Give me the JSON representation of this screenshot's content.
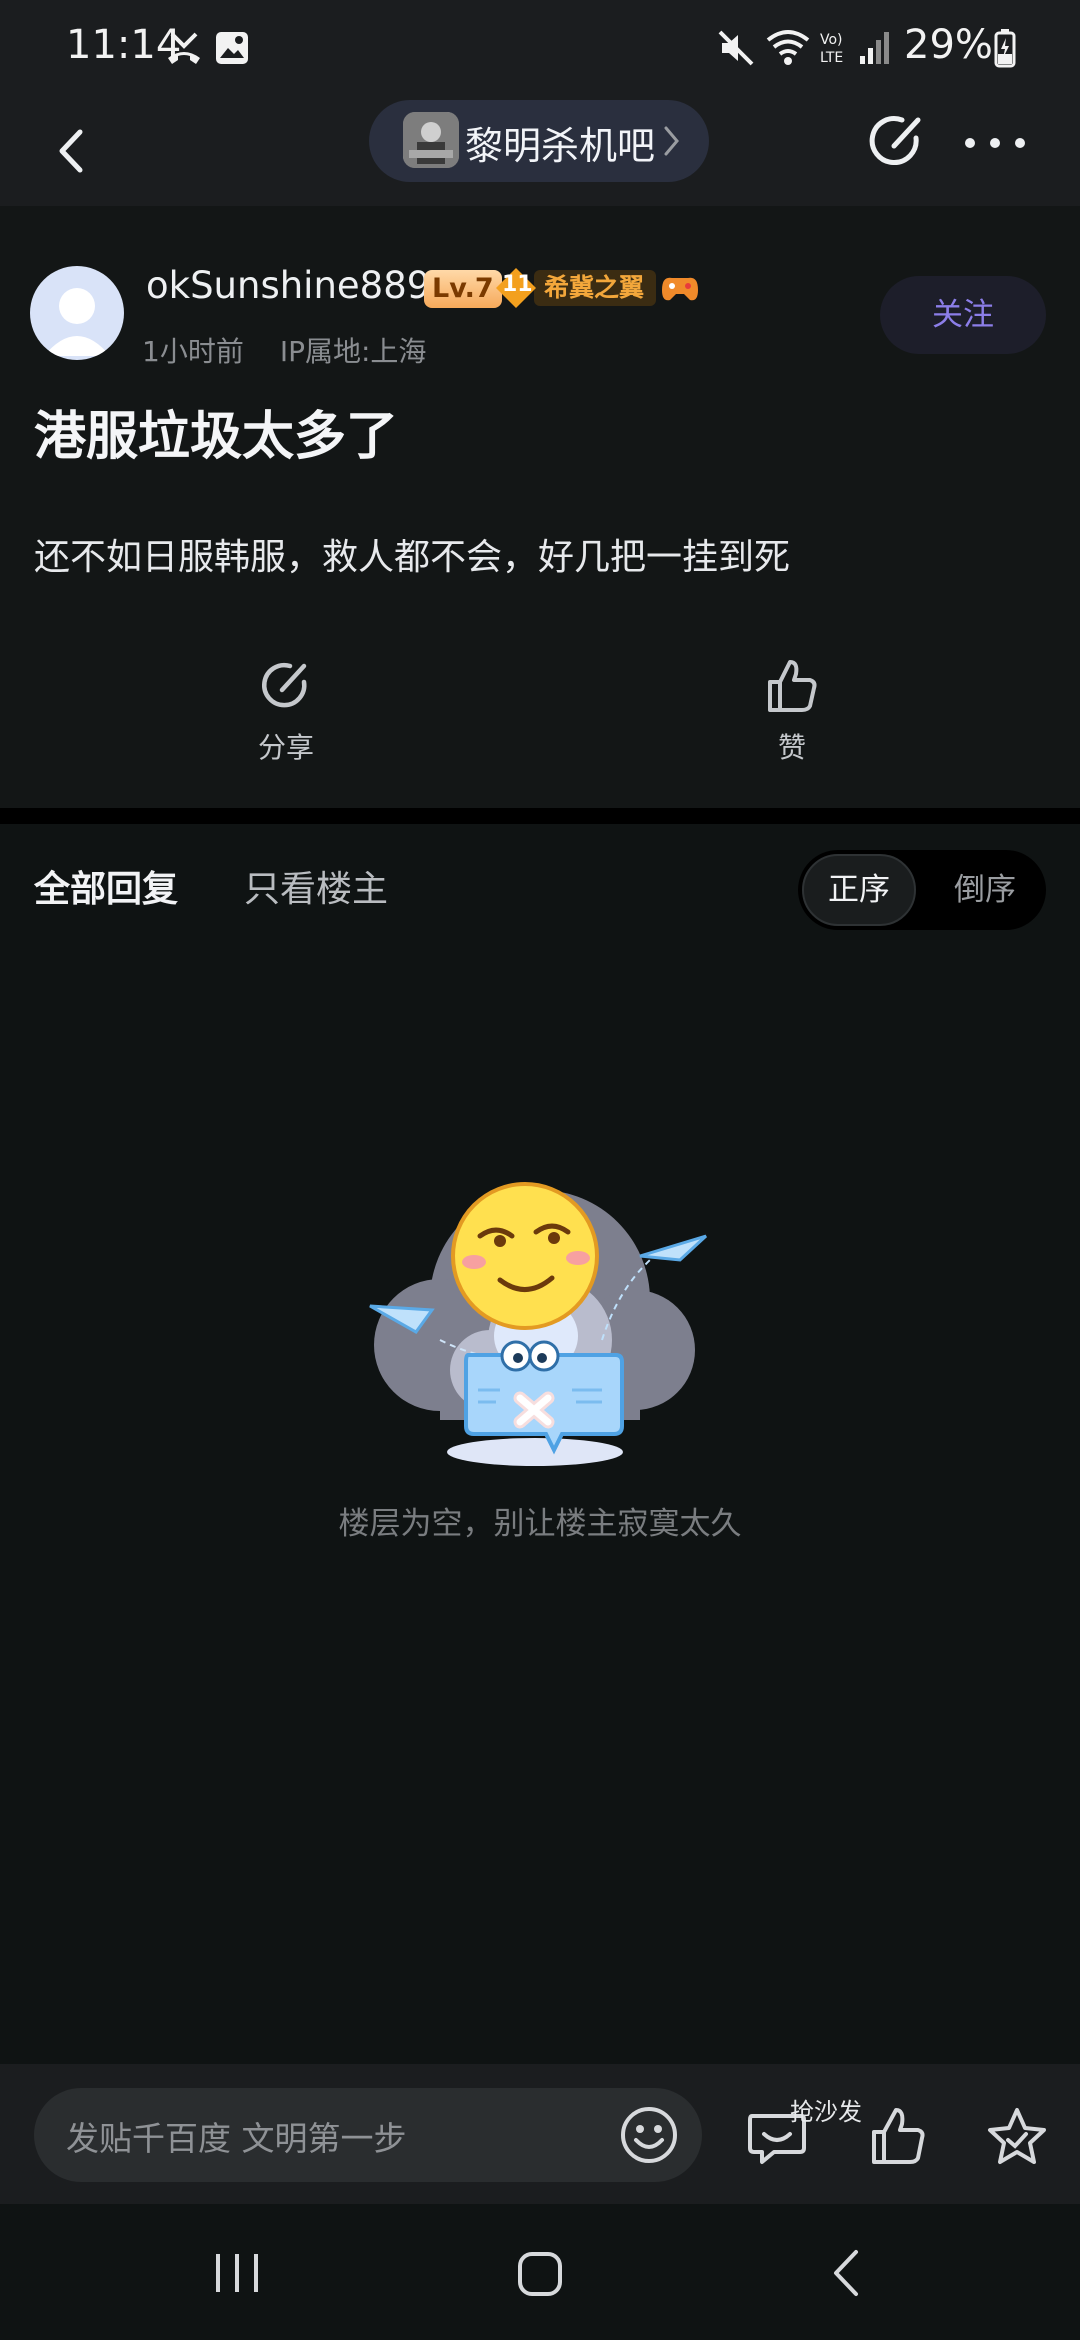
{
  "status_bar": {
    "time": "11:14",
    "battery_percent": "29%",
    "icons": [
      "missed-call-icon",
      "gallery-icon",
      "mute-icon",
      "wifi-icon",
      "volte-icon",
      "signal-icon",
      "battery-charging-icon"
    ]
  },
  "top_nav": {
    "forum_name": "黎明杀机吧",
    "icons": [
      "back-icon",
      "forum-avatar",
      "chevron-right-icon",
      "share-icon",
      "more-icon"
    ]
  },
  "post": {
    "username": "okSunshine889",
    "level_badge": "Lv.7",
    "wing_badge_level": "11",
    "wing_badge_name": "希冀之翼",
    "time_ago": "1小时前",
    "ip_location": "IP属地:上海",
    "follow_label": "关注",
    "title": "港服垃圾太多了",
    "body": "还不如日服韩服，救人都不会，好几把一挂到死",
    "share_label": "分享",
    "like_label": "赞"
  },
  "replies": {
    "tab_all": "全部回复",
    "tab_host_only": "只看楼主",
    "sort_asc": "正序",
    "sort_desc": "倒序",
    "active_sort": "正序",
    "empty_message": "楼层为空，别让楼主寂寞太久"
  },
  "composer": {
    "placeholder": "发贴千百度 文明第一步",
    "sofa_label": "抢沙发"
  },
  "colors": {
    "background": "#0f1313",
    "bar": "#1b1d1f",
    "accent_purple": "#8c7ee8",
    "badge_gold": "#f3a73b"
  }
}
